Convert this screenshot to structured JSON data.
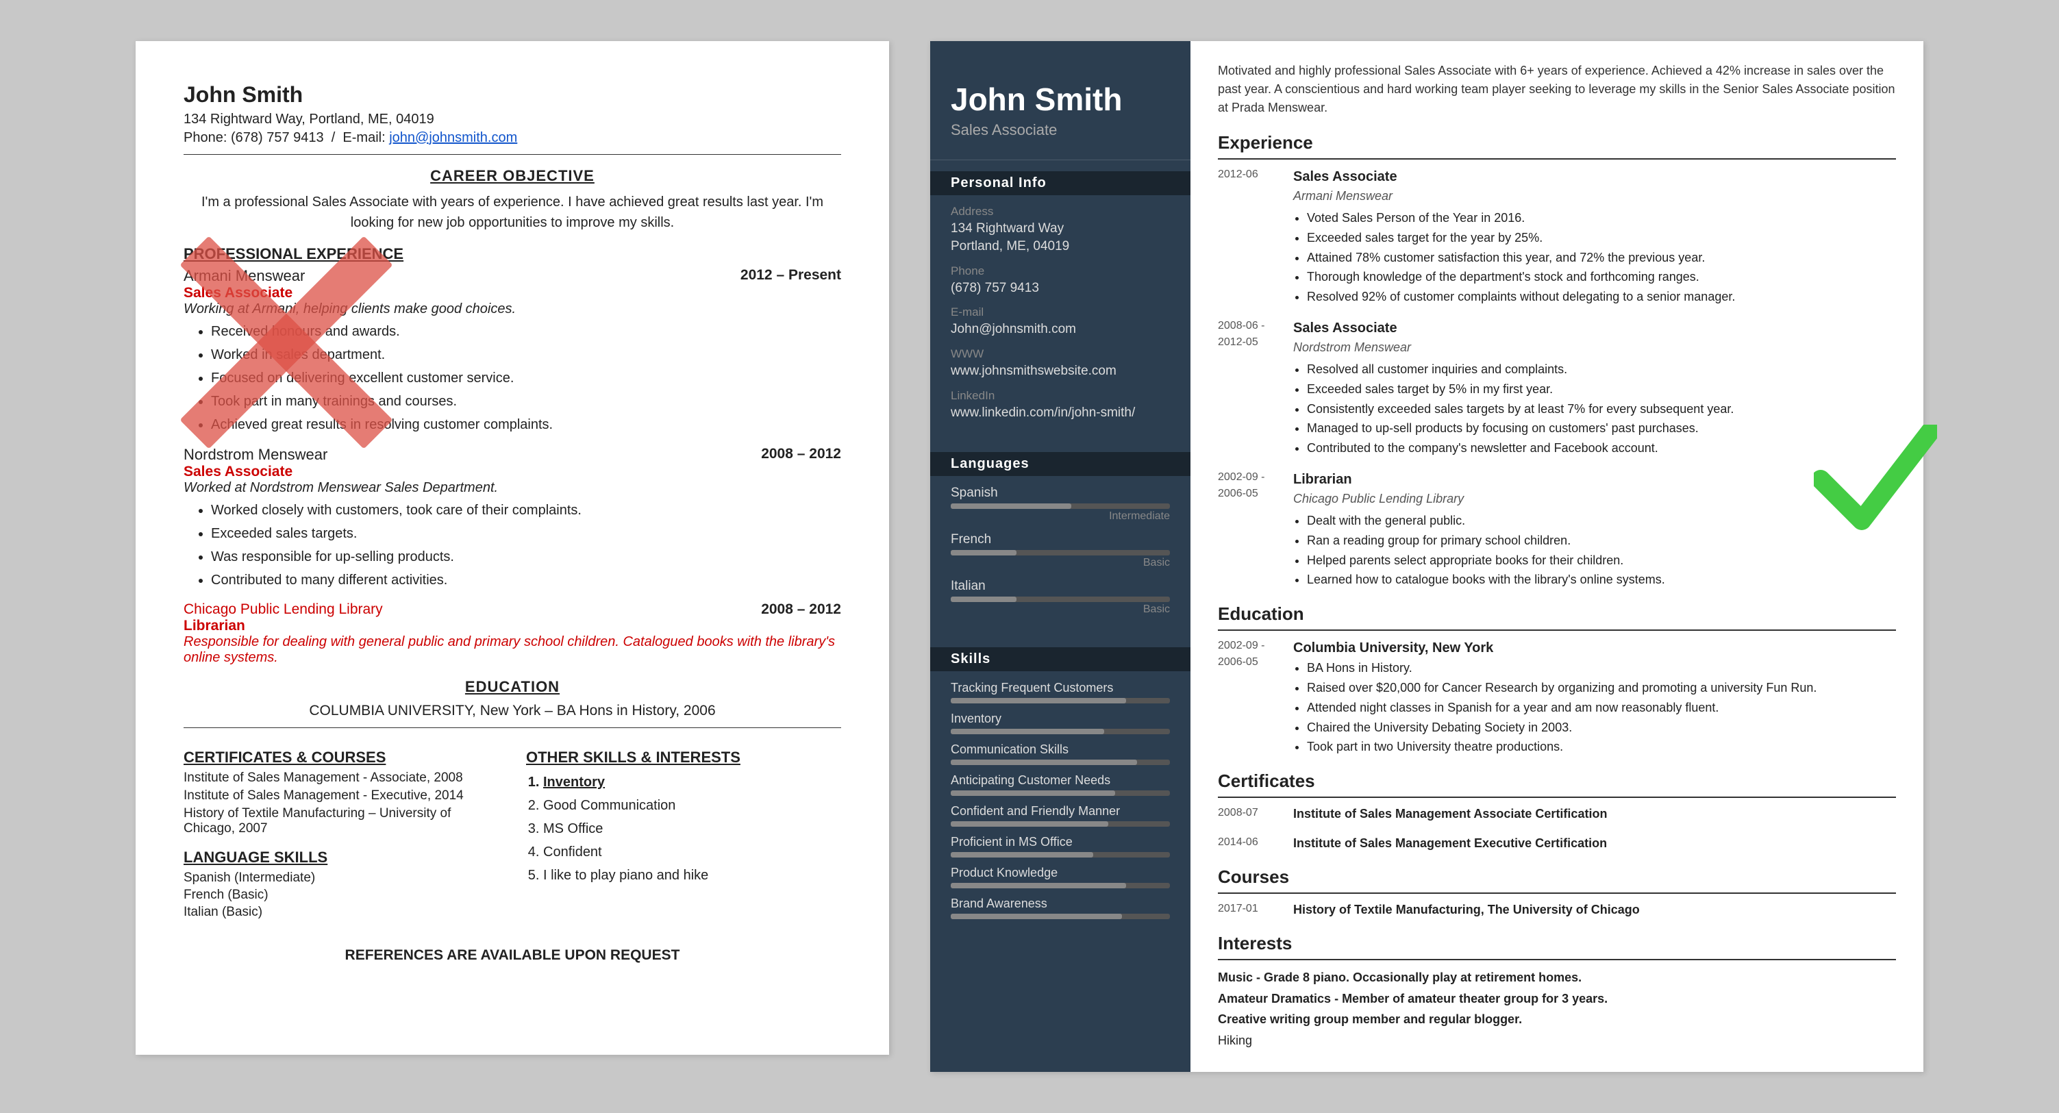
{
  "left_resume": {
    "name": "John Smith",
    "address": "134 Rightward Way, Portland, ME, 04019",
    "phone_label": "Phone:",
    "phone": "(678) 757 9413",
    "email_label": "E-mail:",
    "email": "john@johnsmith.com",
    "career_objective_title": "CAREER OBJECTIVE",
    "career_objective_text": "I'm a professional Sales Associate with years of experience. I have achieved great results last year. I'm looking for new job opportunities to improve my skills.",
    "professional_experience_title": "PROFESSIONAL EXPERIENCE",
    "jobs": [
      {
        "company": "Armani Menswear",
        "title": "Sales Associate",
        "dates": "2012 – Present",
        "desc": "Working at Armani, helping clients make good choices.",
        "bullets": [
          "Received honours and awards.",
          "Worked in sales department.",
          "Focused on delivering excellent customer service.",
          "Took part in many trainings and courses.",
          "Achieved great results in resolving customer complaints."
        ]
      },
      {
        "company": "Nordstrom Menswear",
        "title": "Sales Associate",
        "dates": "2008 – 2012",
        "desc": "Worked at Nordstrom Menswear Sales Department.",
        "bullets": [
          "Worked closely with customers, took care of their complaints.",
          "Exceeded sales targets.",
          "Was responsible for up-selling products.",
          "Contributed to many different activities."
        ]
      },
      {
        "company": "Chicago Public Lending Library",
        "title": "Librarian",
        "dates": "2008 – 2012",
        "desc": "Responsible for dealing with general public and primary school children. Catalogued books with the library's online systems.",
        "bullets": []
      }
    ],
    "education_title": "EDUCATION",
    "education_text": "COLUMBIA UNIVERSITY, New York – BA Hons in History, 2006",
    "certs_title": "CERTIFICATES & COURSES",
    "certs": [
      "Institute of Sales Management - Associate, 2008",
      "Institute of Sales Management - Executive, 2014",
      "History of Textile Manufacturing – University of Chicago, 2007"
    ],
    "other_skills_title": "OTHER SKILLS & INTERESTS",
    "other_skills": [
      "Inventory",
      "Good Communication",
      "MS Office",
      "Confident",
      "I like to play piano and hike"
    ],
    "lang_title": "LANGUAGE SKILLS",
    "languages": [
      "Spanish (Intermediate)",
      "French (Basic)",
      "Italian (Basic)"
    ],
    "references": "REFERENCES ARE AVAILABLE UPON REQUEST"
  },
  "right_resume": {
    "name": "John Smith",
    "job_title": "Sales Associate",
    "summary": "Motivated and highly professional Sales Associate with 6+ years of experience. Achieved a 42% increase in sales over the past year. A conscientious and hard working team player seeking to leverage my skills in the Senior Sales Associate position at Prada Menswear.",
    "personal_info_label": "Personal Info",
    "address_label": "Address",
    "address": "134 Rightward Way\nPortland, ME, 04019",
    "phone_label": "Phone",
    "phone": "(678) 757 9413",
    "email_label": "E-mail",
    "email": "John@johnsmith.com",
    "www_label": "WWW",
    "www": "www.johnsmithswebsite.com",
    "linkedin_label": "LinkedIn",
    "linkedin": "www.linkedin.com/in/john-smith/",
    "languages_label": "Languages",
    "languages": [
      {
        "name": "Spanish",
        "level": "Intermediate",
        "pct": 55
      },
      {
        "name": "French",
        "level": "Basic",
        "pct": 30
      },
      {
        "name": "Italian",
        "level": "Basic",
        "pct": 30
      }
    ],
    "skills_label": "Skills",
    "skills": [
      {
        "name": "Tracking Frequent Customers",
        "pct": 80
      },
      {
        "name": "Inventory",
        "pct": 70
      },
      {
        "name": "Communication Skills",
        "pct": 85
      },
      {
        "name": "Anticipating Customer Needs",
        "pct": 75
      },
      {
        "name": "Confident and Friendly Manner",
        "pct": 72
      },
      {
        "name": "Proficient in MS Office",
        "pct": 65
      },
      {
        "name": "Product Knowledge",
        "pct": 80
      },
      {
        "name": "Brand Awareness",
        "pct": 78
      }
    ],
    "experience_label": "Experience",
    "experience": [
      {
        "dates": "2012-06",
        "title": "Sales Associate",
        "company": "Armani Menswear",
        "bullets": [
          "Voted Sales Person of the Year in 2016.",
          "Exceeded sales target for the year by 25%.",
          "Attained 78% customer satisfaction this year, and 72% the previous year.",
          "Thorough knowledge of the department's stock and forthcoming ranges.",
          "Resolved 92% of customer complaints without delegating to a senior manager."
        ]
      },
      {
        "dates": "2008-06 -\n2012-05",
        "title": "Sales Associate",
        "company": "Nordstrom Menswear",
        "bullets": [
          "Resolved all customer inquiries and complaints.",
          "Exceeded sales target by 5% in my first year.",
          "Consistently exceeded sales targets by at least 7% for every subsequent year.",
          "Managed to up-sell products by focusing on customers' past purchases.",
          "Contributed to the company's newsletter and Facebook account."
        ]
      },
      {
        "dates": "2002-09 -\n2006-05",
        "title": "Librarian",
        "company": "Chicago Public Lending Library",
        "bullets": [
          "Dealt with the general public.",
          "Ran a reading group for primary school children.",
          "Helped parents select appropriate books for their children.",
          "Learned how to catalogue books with the library's online systems."
        ]
      }
    ],
    "education_label": "Education",
    "education": [
      {
        "dates": "2002-09 -\n2006-05",
        "school": "Columbia University, New York",
        "bullets": [
          "BA Hons in History.",
          "Raised over $20,000 for Cancer Research by organizing and promoting a university Fun Run.",
          "Attended night classes in Spanish for a year and am now reasonably fluent.",
          "Chaired the University Debating Society in 2003.",
          "Took part in two University theatre productions."
        ]
      }
    ],
    "certificates_label": "Certificates",
    "certificates": [
      {
        "dates": "2008-07",
        "text": "Institute of Sales Management Associate Certification"
      },
      {
        "dates": "2014-06",
        "text": "Institute of Sales Management Executive Certification"
      }
    ],
    "courses_label": "Courses",
    "courses": [
      {
        "dates": "2017-01",
        "text": "History of Textile Manufacturing, The University of Chicago"
      }
    ],
    "interests_label": "Interests",
    "interests": [
      "Music - Grade 8 piano. Occasionally play at retirement homes.",
      "Amateur Dramatics - Member of amateur theater group for 3 years.",
      "Creative writing group member and regular blogger.",
      "Hiking"
    ]
  }
}
